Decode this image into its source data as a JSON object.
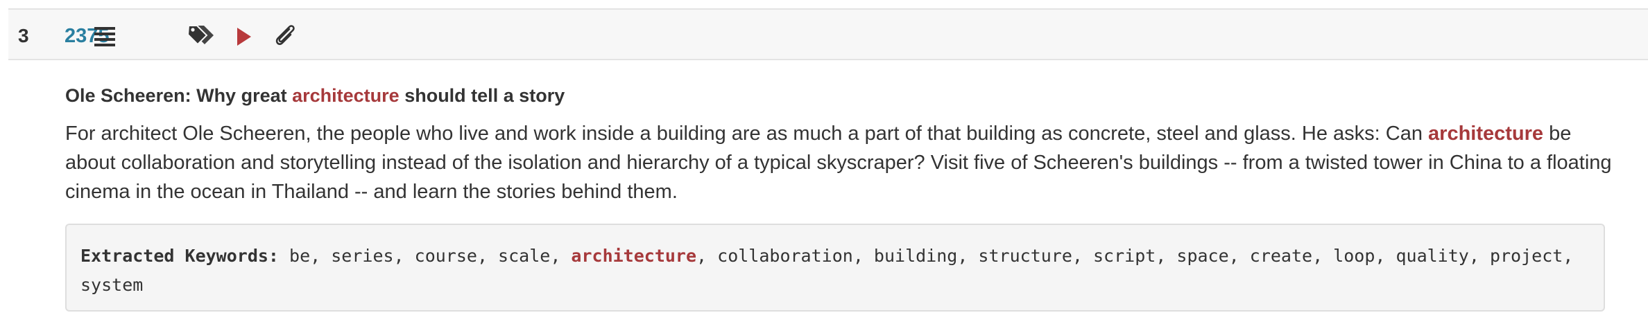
{
  "entry": {
    "rank": "3",
    "talk_id": "2375",
    "icons": [
      "list-icon",
      "tags-icon",
      "play-icon",
      "paperclip-icon"
    ],
    "colors": {
      "link": "#2a7fa0",
      "highlight": "#a6393b",
      "text": "#333333"
    }
  },
  "talk": {
    "title_before": "Ole Scheeren: Why great ",
    "title_highlight": "architecture",
    "title_after": " should tell a story",
    "desc_before": "For architect Ole Scheeren, the people who live and work inside a building are as much a part of that building as concrete, steel and glass. He asks: Can ",
    "desc_highlight": "architecture",
    "desc_after": " be about collaboration and storytelling instead of the isolation and hierarchy of a typical skyscraper? Visit five of Scheeren's buildings -- from a twisted tower in China to a floating cinema in the ocean in Thailand -- and learn the stories behind them."
  },
  "keywords": {
    "label": "Extracted Keywords:",
    "before": " be, series, course, scale, ",
    "highlight": "architecture",
    "after": ", collaboration, building, structure, script, space, create, loop, quality, project, system"
  }
}
